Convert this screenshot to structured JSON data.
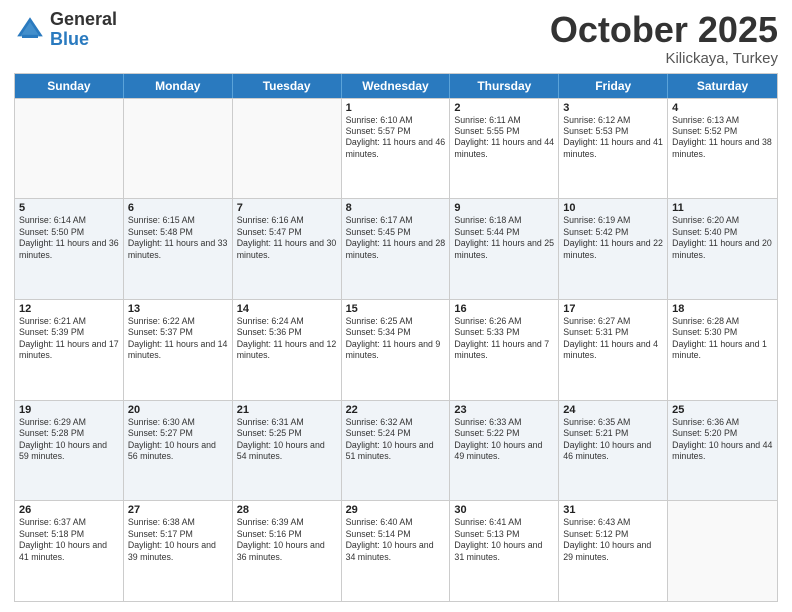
{
  "header": {
    "logo_general": "General",
    "logo_blue": "Blue",
    "month": "October 2025",
    "location": "Kilickaya, Turkey"
  },
  "weekdays": [
    "Sunday",
    "Monday",
    "Tuesday",
    "Wednesday",
    "Thursday",
    "Friday",
    "Saturday"
  ],
  "rows": [
    [
      {
        "day": "",
        "info": ""
      },
      {
        "day": "",
        "info": ""
      },
      {
        "day": "",
        "info": ""
      },
      {
        "day": "1",
        "info": "Sunrise: 6:10 AM\nSunset: 5:57 PM\nDaylight: 11 hours and 46 minutes."
      },
      {
        "day": "2",
        "info": "Sunrise: 6:11 AM\nSunset: 5:55 PM\nDaylight: 11 hours and 44 minutes."
      },
      {
        "day": "3",
        "info": "Sunrise: 6:12 AM\nSunset: 5:53 PM\nDaylight: 11 hours and 41 minutes."
      },
      {
        "day": "4",
        "info": "Sunrise: 6:13 AM\nSunset: 5:52 PM\nDaylight: 11 hours and 38 minutes."
      }
    ],
    [
      {
        "day": "5",
        "info": "Sunrise: 6:14 AM\nSunset: 5:50 PM\nDaylight: 11 hours and 36 minutes."
      },
      {
        "day": "6",
        "info": "Sunrise: 6:15 AM\nSunset: 5:48 PM\nDaylight: 11 hours and 33 minutes."
      },
      {
        "day": "7",
        "info": "Sunrise: 6:16 AM\nSunset: 5:47 PM\nDaylight: 11 hours and 30 minutes."
      },
      {
        "day": "8",
        "info": "Sunrise: 6:17 AM\nSunset: 5:45 PM\nDaylight: 11 hours and 28 minutes."
      },
      {
        "day": "9",
        "info": "Sunrise: 6:18 AM\nSunset: 5:44 PM\nDaylight: 11 hours and 25 minutes."
      },
      {
        "day": "10",
        "info": "Sunrise: 6:19 AM\nSunset: 5:42 PM\nDaylight: 11 hours and 22 minutes."
      },
      {
        "day": "11",
        "info": "Sunrise: 6:20 AM\nSunset: 5:40 PM\nDaylight: 11 hours and 20 minutes."
      }
    ],
    [
      {
        "day": "12",
        "info": "Sunrise: 6:21 AM\nSunset: 5:39 PM\nDaylight: 11 hours and 17 minutes."
      },
      {
        "day": "13",
        "info": "Sunrise: 6:22 AM\nSunset: 5:37 PM\nDaylight: 11 hours and 14 minutes."
      },
      {
        "day": "14",
        "info": "Sunrise: 6:24 AM\nSunset: 5:36 PM\nDaylight: 11 hours and 12 minutes."
      },
      {
        "day": "15",
        "info": "Sunrise: 6:25 AM\nSunset: 5:34 PM\nDaylight: 11 hours and 9 minutes."
      },
      {
        "day": "16",
        "info": "Sunrise: 6:26 AM\nSunset: 5:33 PM\nDaylight: 11 hours and 7 minutes."
      },
      {
        "day": "17",
        "info": "Sunrise: 6:27 AM\nSunset: 5:31 PM\nDaylight: 11 hours and 4 minutes."
      },
      {
        "day": "18",
        "info": "Sunrise: 6:28 AM\nSunset: 5:30 PM\nDaylight: 11 hours and 1 minute."
      }
    ],
    [
      {
        "day": "19",
        "info": "Sunrise: 6:29 AM\nSunset: 5:28 PM\nDaylight: 10 hours and 59 minutes."
      },
      {
        "day": "20",
        "info": "Sunrise: 6:30 AM\nSunset: 5:27 PM\nDaylight: 10 hours and 56 minutes."
      },
      {
        "day": "21",
        "info": "Sunrise: 6:31 AM\nSunset: 5:25 PM\nDaylight: 10 hours and 54 minutes."
      },
      {
        "day": "22",
        "info": "Sunrise: 6:32 AM\nSunset: 5:24 PM\nDaylight: 10 hours and 51 minutes."
      },
      {
        "day": "23",
        "info": "Sunrise: 6:33 AM\nSunset: 5:22 PM\nDaylight: 10 hours and 49 minutes."
      },
      {
        "day": "24",
        "info": "Sunrise: 6:35 AM\nSunset: 5:21 PM\nDaylight: 10 hours and 46 minutes."
      },
      {
        "day": "25",
        "info": "Sunrise: 6:36 AM\nSunset: 5:20 PM\nDaylight: 10 hours and 44 minutes."
      }
    ],
    [
      {
        "day": "26",
        "info": "Sunrise: 6:37 AM\nSunset: 5:18 PM\nDaylight: 10 hours and 41 minutes."
      },
      {
        "day": "27",
        "info": "Sunrise: 6:38 AM\nSunset: 5:17 PM\nDaylight: 10 hours and 39 minutes."
      },
      {
        "day": "28",
        "info": "Sunrise: 6:39 AM\nSunset: 5:16 PM\nDaylight: 10 hours and 36 minutes."
      },
      {
        "day": "29",
        "info": "Sunrise: 6:40 AM\nSunset: 5:14 PM\nDaylight: 10 hours and 34 minutes."
      },
      {
        "day": "30",
        "info": "Sunrise: 6:41 AM\nSunset: 5:13 PM\nDaylight: 10 hours and 31 minutes."
      },
      {
        "day": "31",
        "info": "Sunrise: 6:43 AM\nSunset: 5:12 PM\nDaylight: 10 hours and 29 minutes."
      },
      {
        "day": "",
        "info": ""
      }
    ]
  ]
}
